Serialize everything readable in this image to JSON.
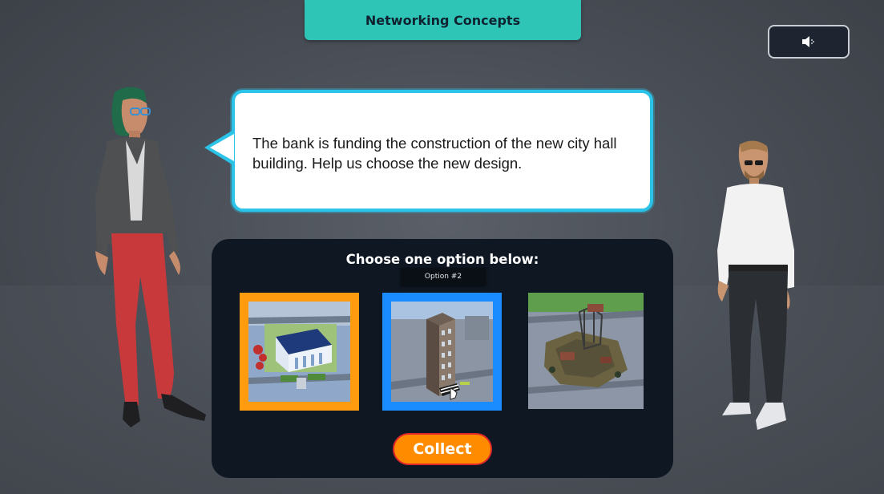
{
  "header": {
    "title": "Networking Concepts"
  },
  "sound": {
    "icon": "speaker-icon"
  },
  "dialog": {
    "text": "The bank is funding the construction of the new city hall building. Help us choose the new design."
  },
  "choices": {
    "prompt": "Choose one option below:",
    "tooltip": "Option #2",
    "options": [
      {
        "name": "classic-bank-building",
        "state": "selected",
        "border_color": "#ff9b0f"
      },
      {
        "name": "tall-tower-building",
        "state": "hover",
        "border_color": "#1a8cff"
      },
      {
        "name": "ruined-construction-site",
        "state": "default"
      }
    ],
    "action_label": "Collect"
  },
  "colors": {
    "accent_teal": "#2ec4b6",
    "bubble_border": "#2bc4e8",
    "panel_bg": "#0f1722",
    "collect": "#ff8c00"
  }
}
